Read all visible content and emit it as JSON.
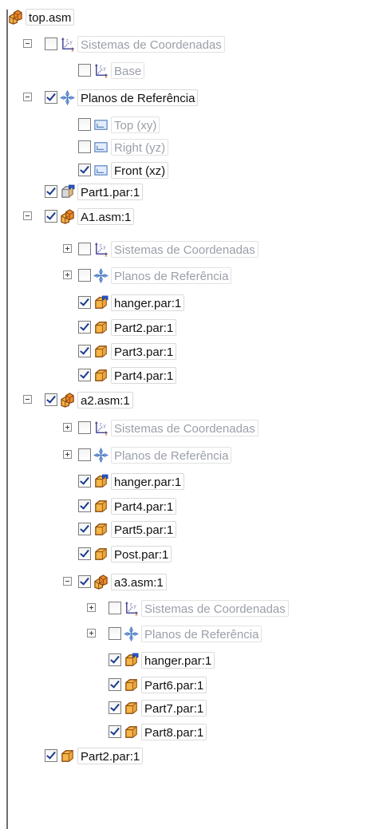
{
  "tree": {
    "rows": [
      {
        "label": "top.asm",
        "icon": "assembly-icon",
        "expander": "none",
        "checkbox": "none",
        "dim": false
      },
      {
        "label": "Sistemas de Coordenadas",
        "icon": "coordinate-system-icon",
        "expander": "minus",
        "checkbox": "unchecked",
        "dim": true
      },
      {
        "label": "Base",
        "icon": "coordinate-system-icon",
        "expander": "none",
        "checkbox": "unchecked",
        "dim": true
      },
      {
        "label": "Planos de Referência",
        "icon": "reference-planes-icon",
        "expander": "minus",
        "checkbox": "checked",
        "dim": false
      },
      {
        "label": "Top (xy)",
        "icon": "plane-icon",
        "expander": "none",
        "checkbox": "unchecked",
        "dim": true
      },
      {
        "label": "Right (yz)",
        "icon": "plane-icon",
        "expander": "none",
        "checkbox": "unchecked",
        "dim": true
      },
      {
        "label": "Front (xz)",
        "icon": "plane-icon",
        "expander": "none",
        "checkbox": "checked",
        "dim": false
      },
      {
        "label": "Part1.par:1",
        "icon": "part-blue-icon",
        "expander": "none",
        "checkbox": "checked",
        "dim": false
      },
      {
        "label": "A1.asm:1",
        "icon": "assembly-icon",
        "expander": "minus",
        "checkbox": "checked",
        "dim": false
      },
      {
        "label": "Sistemas de Coordenadas",
        "icon": "coordinate-system-icon",
        "expander": "plus",
        "checkbox": "unchecked",
        "dim": true
      },
      {
        "label": "Planos de Referência",
        "icon": "reference-planes-icon",
        "expander": "plus",
        "checkbox": "unchecked",
        "dim": true
      },
      {
        "label": "hanger.par:1",
        "icon": "part-hanger-icon",
        "expander": "none",
        "checkbox": "checked",
        "dim": false
      },
      {
        "label": "Part2.par:1",
        "icon": "part-icon",
        "expander": "none",
        "checkbox": "checked",
        "dim": false
      },
      {
        "label": "Part3.par:1",
        "icon": "part-icon",
        "expander": "none",
        "checkbox": "checked",
        "dim": false
      },
      {
        "label": "Part4.par:1",
        "icon": "part-icon",
        "expander": "none",
        "checkbox": "checked",
        "dim": false
      },
      {
        "label": "a2.asm:1",
        "icon": "assembly-icon",
        "expander": "minus",
        "checkbox": "checked",
        "dim": false
      },
      {
        "label": "Sistemas de Coordenadas",
        "icon": "coordinate-system-icon",
        "expander": "plus",
        "checkbox": "unchecked",
        "dim": true
      },
      {
        "label": "Planos de Referência",
        "icon": "reference-planes-icon",
        "expander": "plus",
        "checkbox": "unchecked",
        "dim": true
      },
      {
        "label": "hanger.par:1",
        "icon": "part-hanger-icon",
        "expander": "none",
        "checkbox": "checked",
        "dim": false
      },
      {
        "label": "Part4.par:1",
        "icon": "part-icon",
        "expander": "none",
        "checkbox": "checked",
        "dim": false
      },
      {
        "label": "Part5.par:1",
        "icon": "part-icon",
        "expander": "none",
        "checkbox": "checked",
        "dim": false
      },
      {
        "label": "Post.par:1",
        "icon": "part-icon",
        "expander": "none",
        "checkbox": "checked",
        "dim": false
      },
      {
        "label": "a3.asm:1",
        "icon": "assembly-icon",
        "expander": "minus",
        "checkbox": "checked",
        "dim": false
      },
      {
        "label": "Sistemas de Coordenadas",
        "icon": "coordinate-system-icon",
        "expander": "plus",
        "checkbox": "unchecked",
        "dim": true
      },
      {
        "label": "Planos de Referência",
        "icon": "reference-planes-icon",
        "expander": "plus",
        "checkbox": "unchecked",
        "dim": true
      },
      {
        "label": "hanger.par:1",
        "icon": "part-hanger-icon",
        "expander": "none",
        "checkbox": "checked",
        "dim": false
      },
      {
        "label": "Part6.par:1",
        "icon": "part-icon",
        "expander": "none",
        "checkbox": "checked",
        "dim": false
      },
      {
        "label": "Part7.par:1",
        "icon": "part-icon",
        "expander": "none",
        "checkbox": "checked",
        "dim": false
      },
      {
        "label": "Part8.par:1",
        "icon": "part-icon",
        "expander": "none",
        "checkbox": "checked",
        "dim": false
      },
      {
        "label": "Part2.par:1",
        "icon": "part-icon",
        "expander": "none",
        "checkbox": "checked",
        "dim": false
      }
    ]
  }
}
